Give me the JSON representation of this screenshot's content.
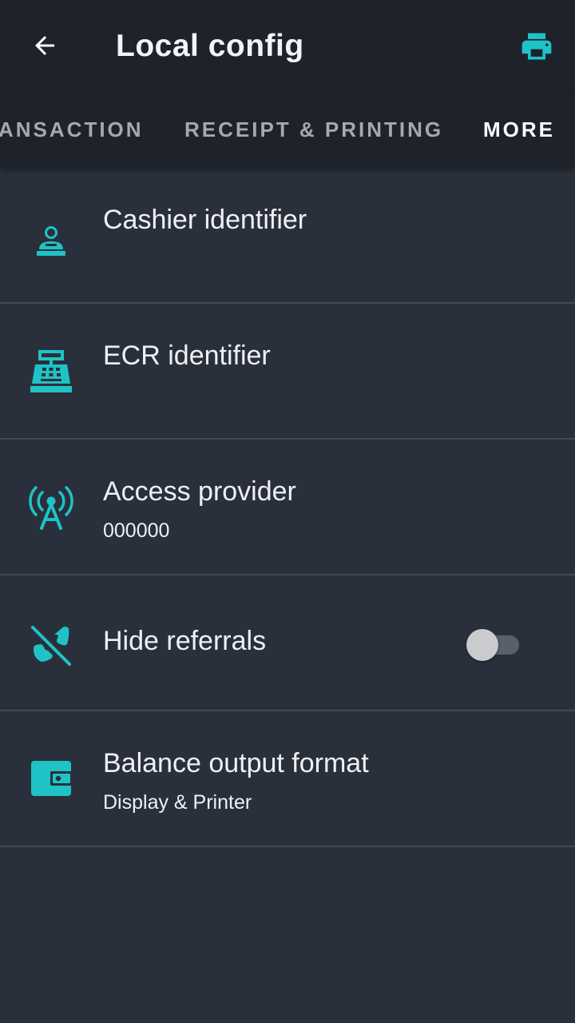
{
  "appbar": {
    "title": "Local config",
    "back_icon": "arrow-left-icon",
    "print_icon": "printer-icon"
  },
  "tabs": [
    {
      "label": "TRANSACTION",
      "visible_text": "ANSACTION",
      "active": false
    },
    {
      "label": "RECEIPT & PRINTING",
      "active": false
    },
    {
      "label": "MORE",
      "active": true
    }
  ],
  "settings": [
    {
      "label": "Cashier identifier",
      "subtitle": "",
      "icon": "cashier-icon"
    },
    {
      "label": "ECR identifier",
      "subtitle": "",
      "icon": "cash-register-icon"
    },
    {
      "label": "Access provider",
      "subtitle": "000000",
      "icon": "antenna-icon"
    },
    {
      "label": "Hide referrals",
      "subtitle": "",
      "icon": "phone-off-icon",
      "toggle_on": false
    },
    {
      "label": "Balance output format",
      "subtitle": "Display & Printer",
      "icon": "wallet-icon"
    }
  ],
  "colors": {
    "accent": "#1fc3c6",
    "appbar_bg": "#1d222b",
    "content_bg": "#2a303b",
    "divider": "#434a55"
  }
}
